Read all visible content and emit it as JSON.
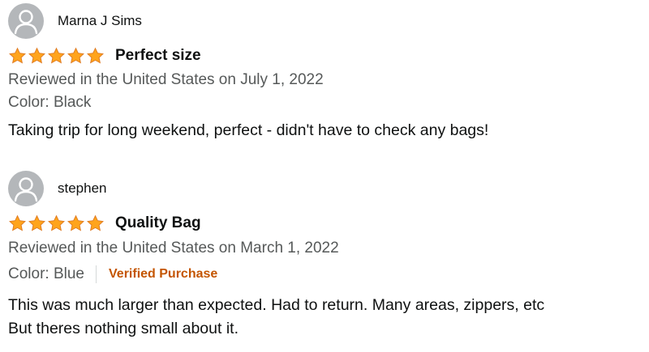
{
  "reviews": [
    {
      "author": "Marna J Sims",
      "rating": 5,
      "title": "Perfect size",
      "reviewed_in": "Reviewed in the United States on July 1, 2022",
      "color": "Color: Black",
      "body_lines": [
        "Taking trip for long weekend, perfect - didn't have to check any bags!"
      ]
    },
    {
      "author": "stephen",
      "rating": 5,
      "title": "Quality Bag",
      "reviewed_in": "Reviewed in the United States on March 1, 2022",
      "color": "Color: Blue",
      "verified": "Verified Purchase",
      "body_lines": [
        "This was much larger than expected. Had to return. Many areas, zippers, etc",
        "But theres nothing small about it."
      ]
    }
  ],
  "icons": {
    "avatar": "default-avatar-icon",
    "star": "star-filled-icon"
  },
  "colors": {
    "star": "#ffa41c",
    "star_outline": "#de7921",
    "verified": "#c45500",
    "meta_text": "#565959",
    "avatar_bg": "#b4b7ba"
  }
}
